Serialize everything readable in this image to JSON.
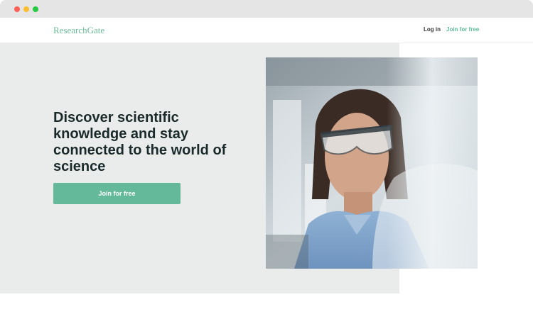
{
  "brand": {
    "name": "ResearchGate"
  },
  "nav": {
    "login_label": "Log in",
    "join_label": "Join for free"
  },
  "hero": {
    "headline": "Discover scientific knowledge and stay connected to the world of science",
    "cta_label": "Join for free"
  },
  "colors": {
    "accent": "#64b99a",
    "hero_background": "#eaeceb",
    "headline": "#1a2a2a"
  }
}
